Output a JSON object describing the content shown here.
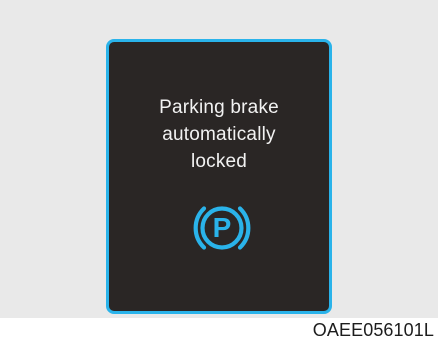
{
  "display": {
    "message_lines": [
      "Parking brake",
      "automatically",
      "locked"
    ],
    "indicator": {
      "icon": "parking-brake-p-icon",
      "label": "P",
      "color": "#2ab3ea"
    },
    "border_color": "#2ab3ea",
    "background_color": "#2a2625"
  },
  "figure_code": "OAEE056101L"
}
